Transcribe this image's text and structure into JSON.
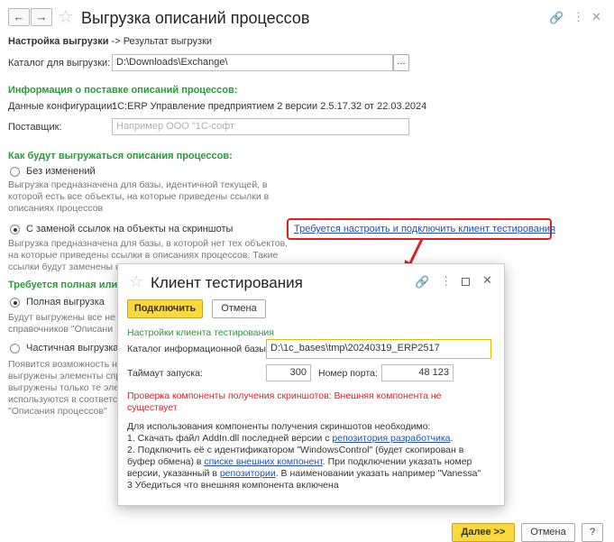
{
  "window": {
    "title": "Выгрузка описаний процессов",
    "breadcrumb_current": "Настройка выгрузки",
    "breadcrumb_sep": "->",
    "breadcrumb_next": "Результат выгрузки"
  },
  "catalog": {
    "label": "Каталог для выгрузки:",
    "value": "D:\\Downloads\\Exchange\\",
    "browse": "..."
  },
  "info": {
    "heading": "Информация о поставке описаний процессов:",
    "config_label": "Данные конфигурации:",
    "config_value": "1С:ERP Управление предприятием 2 версии 2.5.17.32 от 22.03.2024",
    "supplier_label": "Поставщик:",
    "supplier_placeholder": "Например ООО \"1С-софт"
  },
  "mode": {
    "heading": "Как будут выгружаться описания процессов:",
    "opt1": "Без изменений",
    "opt1_desc": "Выгрузка предназначена для базы, идентичной текущей, в которой есть все объекты, на которые приведены ссылки в описаниях процессов",
    "opt2": "С заменой ссылок на объекты на скриншоты",
    "opt2_desc_l1": "Выгрузка предназначена для базы, в которой нет тех объектов,",
    "opt2_desc_l2": "на которые приведены ссылки в описаниях процессов. Такие",
    "opt2_desc_l3": "ссылки будут заменены на скриншоты",
    "test_client_link": "Требуется настроить и подключить клиент тестирования"
  },
  "full": {
    "heading": "Требуется полная или",
    "opt_full": "Полная выгрузка",
    "full_desc_l1": "Будут выгружены все не",
    "full_desc_l2": "справочников \"Описани",
    "opt_partial": "Частичная выгрузка",
    "partial_desc_l1": "Появится возможность н",
    "partial_desc_l2": "выгружены элементы спр",
    "partial_desc_l3": "выгружены только те эле",
    "partial_desc_l4": "используются в соответс",
    "partial_desc_l5": "\"Описания процессов\""
  },
  "footer": {
    "next": "Далее >>",
    "cancel": "Отмена",
    "help": "?"
  },
  "modal": {
    "title": "Клиент тестирования",
    "connect": "Подключить",
    "cancel": "Отмена",
    "settings_heading": "Настройки клиента тестирования",
    "ib_label": "Каталог информационной базы:",
    "ib_value": "D:\\1c_bases\\tmp\\20240319_ERP2517",
    "timeout_label": "Таймаут запуска:",
    "timeout_value": "300",
    "port_label": "Номер порта:",
    "port_value": "48 123",
    "error_l1": "Проверка компоненты получения скриншотов: Внешняя компонента не",
    "error_l2": "существует",
    "instr_l1": "Для использования компоненты получения скриншотов необходимо:",
    "instr_l2_pre": "1. Скачать файл AddIn.dll последней версии с ",
    "instr_l2_link": "репозитория разработчика",
    "instr_l2_post": ".",
    "instr_l3": "2. Подключить её с идентификатором \"WindowsControl\" (будет скопирован в",
    "instr_l4_pre": "буфер обмена) в ",
    "instr_l4_link": "списке внешних компонент",
    "instr_l4_post": ". При подключении указать номер",
    "instr_l5_pre": "версии, указанный в ",
    "instr_l5_link": "репозитории",
    "instr_l5_post": ". В наименовании указать например \"Vanessa\"",
    "instr_l6": "3  Убедиться что внешняя компонента включена"
  },
  "colors": {
    "accent_green": "#2a9a3a",
    "primary_yellow": "#fcd93a",
    "link_blue": "#1f4fb4",
    "error_red": "#e0202a",
    "highlight_red": "#e02020"
  }
}
